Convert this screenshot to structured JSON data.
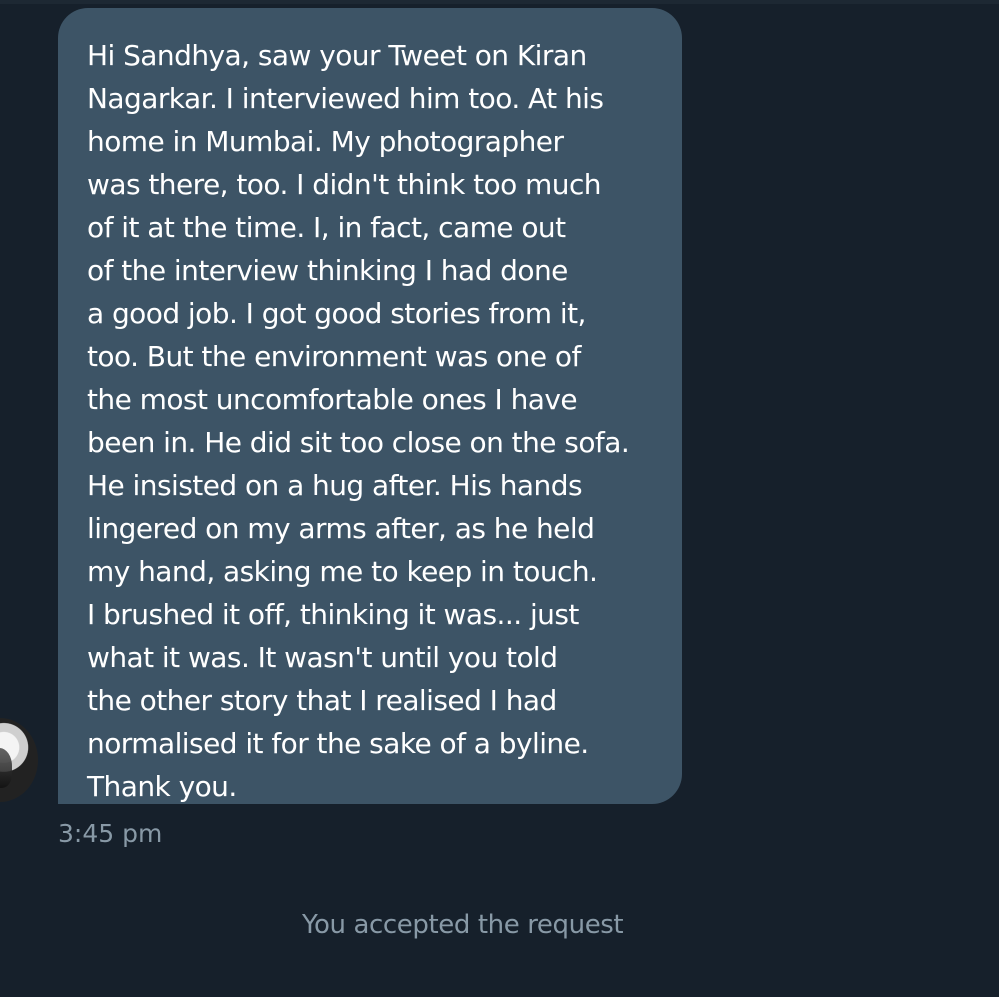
{
  "conversation": {
    "message": {
      "lines": [
        "Hi Sandhya, saw your Tweet on Kiran",
        "Nagarkar. I interviewed him too. At his",
        "home in Mumbai. My photographer",
        "was there, too. I didn't think too much",
        "of it at the time. I, in fact, came out",
        "of the interview thinking I had done",
        "a good job. I got good stories from it,",
        "too. But the environment was one of",
        "the most uncomfortable ones I have",
        "been in. He did sit too close on the sofa.",
        "He insisted on a hug after. His hands",
        "lingered on my arms after, as he held",
        "my hand, asking me to keep in touch.",
        "I brushed it off, thinking it was... just",
        "what it was. It wasn't until you told",
        "the other story that I realised I had",
        "normalised it for the sake of a byline.",
        "Thank you."
      ],
      "timestamp": "3:45 pm"
    },
    "system_note": "You accepted the request",
    "colors": {
      "background": "#16202b",
      "bubble": "#3d5466",
      "message_text": "#ffffff",
      "muted_text": "#8899a6"
    },
    "icons": {
      "avatar": "profile-avatar"
    }
  }
}
